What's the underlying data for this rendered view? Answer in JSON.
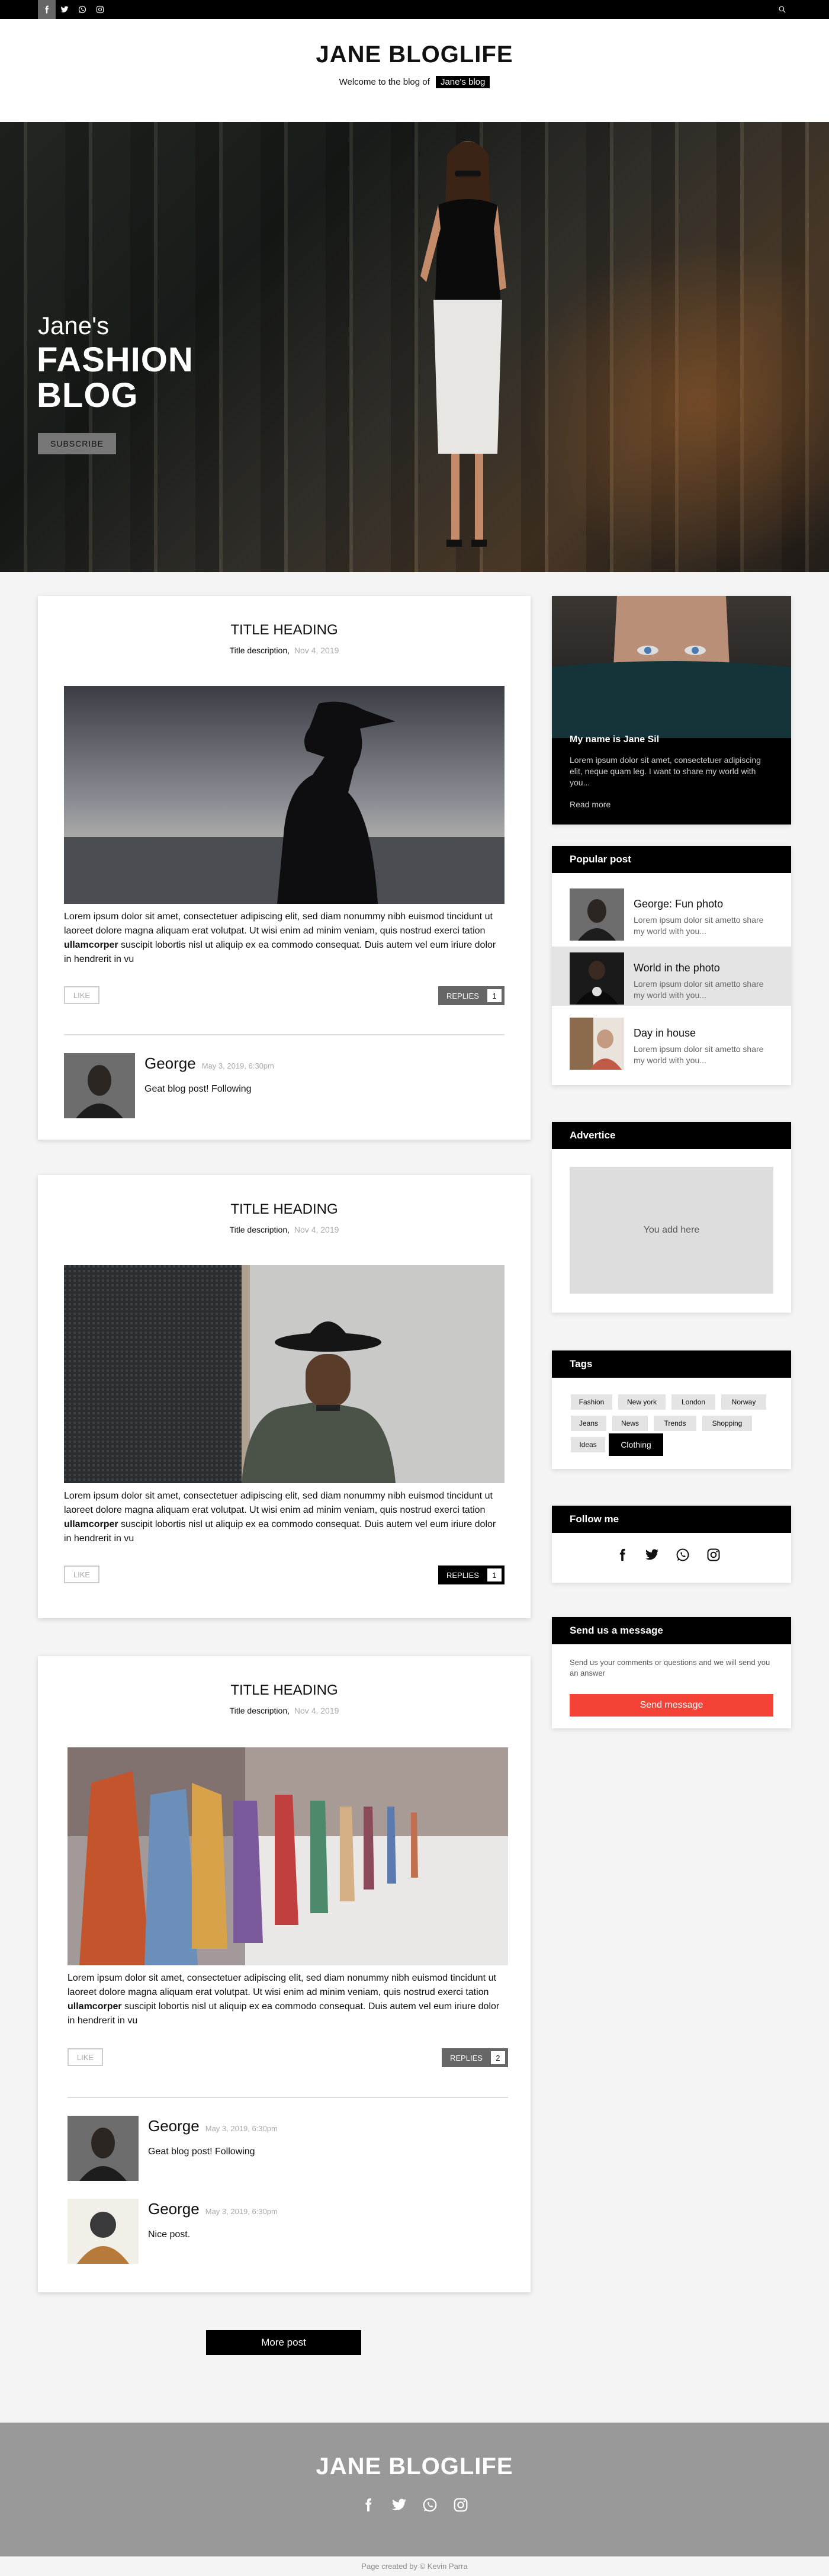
{
  "topbar": {
    "social_icons": [
      "facebook-icon",
      "twitter-icon",
      "whatsapp-icon",
      "instagram-icon"
    ],
    "search_icon": "search-icon"
  },
  "header": {
    "title": "JANE BLOGLIFE",
    "welcome": "Welcome to the blog of",
    "tag": "Jane's blog"
  },
  "hero": {
    "line1": "Jane's",
    "line2": "FASHION",
    "line3": "BLOG",
    "button": "SUBSCRIBE"
  },
  "posts": [
    {
      "title": "TITLE HEADING",
      "description": "Title description,",
      "date": "Nov 4, 2019",
      "body_before": "Lorem ipsum dolor sit amet, consectetuer adipiscing elit, sed diam nonummy nibh euismod tincidunt ut laoreet dolore magna aliquam erat volutpat. Ut wisi enim ad minim veniam, quis nostrud exerci tation ",
      "body_bold": "ullamcorper",
      "body_after": " suscipit lobortis nisl ut aliquip ex ea commodo consequat. Duis autem vel eum iriure dolor in hendrerit in vu",
      "like": "LIKE",
      "replies": "REPLIES",
      "reply_count": "1",
      "comments": [
        {
          "name": "George",
          "date": "May 3, 2019, 6:30pm",
          "text": "Geat blog post! Following"
        }
      ]
    },
    {
      "title": "TITLE HEADING",
      "description": "Title description,",
      "date": "Nov 4, 2019",
      "body_before": "Lorem ipsum dolor sit amet, consectetuer adipiscing elit, sed diam nonummy nibh euismod tincidunt ut laoreet dolore magna aliquam erat volutpat. Ut wisi enim ad minim veniam, quis nostrud exerci tation ",
      "body_bold": "ullamcorper",
      "body_after": " suscipit lobortis nisl ut aliquip ex ea commodo consequat. Duis autem vel eum iriure dolor in hendrerit in vu",
      "like": "LIKE",
      "replies": "REPLIES",
      "reply_count": "1"
    },
    {
      "title": "TITLE HEADING",
      "description": "Title description,",
      "date": "Nov 4, 2019",
      "body_before": "Lorem ipsum dolor sit amet, consectetuer adipiscing elit, sed diam nonummy nibh euismod tincidunt ut laoreet dolore magna aliquam erat volutpat. Ut wisi enim ad minim veniam, quis nostrud exerci tation ",
      "body_bold": "ullamcorper",
      "body_after": " suscipit lobortis nisl ut aliquip ex ea commodo consequat. Duis autem vel eum iriure dolor in hendrerit in vu",
      "like": "LIKE",
      "replies": "REPLIES",
      "reply_count": "2",
      "comments": [
        {
          "name": "George",
          "date": "May 3, 2019, 6:30pm",
          "text": "Geat blog post! Following"
        },
        {
          "name": "George",
          "date": "May 3, 2019, 6:30pm",
          "text": "Nice post."
        }
      ]
    }
  ],
  "more_button": "More post",
  "sidebar": {
    "about": {
      "name": "My name is Jane Sil",
      "text": "Lorem ipsum dolor sit amet, consectetuer adipiscing elit, neque quam leg. I want to share my world with you...",
      "link": "Read more"
    },
    "popular": {
      "heading": "Popular post",
      "items": [
        {
          "title": "George: Fun photo",
          "text": "Lorem ipsum dolor sit ametto share my world with you..."
        },
        {
          "title": "World in the photo",
          "text": "Lorem ipsum dolor sit ametto share my world with you..."
        },
        {
          "title": "Day in house",
          "text": "Lorem ipsum dolor sit ametto share my world with you..."
        }
      ]
    },
    "advertice": {
      "heading": "Advertice",
      "placeholder": "You add here"
    },
    "tags": {
      "heading": "Tags",
      "items": [
        "Fashion",
        "New york",
        "London",
        "Norway",
        "Jeans",
        "News",
        "Trends",
        "Shopping",
        "Ideas",
        "Clothing"
      ]
    },
    "follow": {
      "heading": "Follow me",
      "icons": [
        "facebook-icon",
        "twitter-icon",
        "whatsapp-icon",
        "instagram-icon"
      ]
    },
    "message": {
      "heading": "Send us a message",
      "text": "Send us your comments or questions and we will send you an answer",
      "button": "Send message"
    }
  },
  "footer": {
    "title": "JANE BLOGLIFE",
    "icons": [
      "facebook-icon",
      "twitter-icon",
      "whatsapp-icon",
      "instagram-icon"
    ],
    "credit": "Page created by © Kevin Parra"
  },
  "colors": {
    "accent": "#f44336",
    "dark": "#000000",
    "gray": "#999999"
  }
}
